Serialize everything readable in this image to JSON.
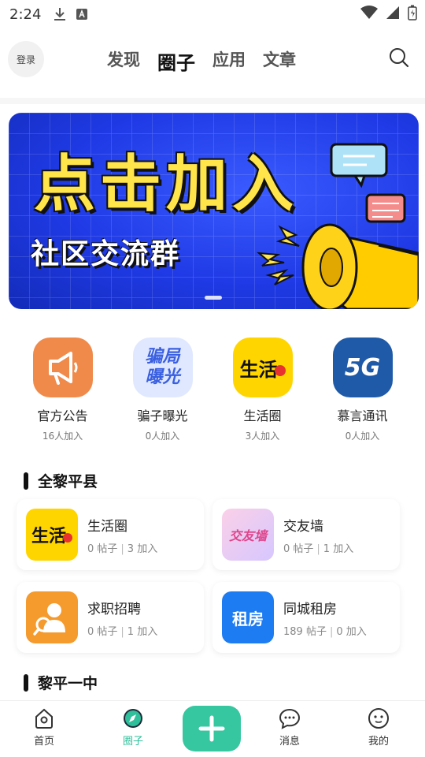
{
  "status_bar": {
    "time": "2:24"
  },
  "top_nav": {
    "login": "登录",
    "tabs": [
      "发现",
      "圈子",
      "应用",
      "文章"
    ],
    "active_tab": "圈子"
  },
  "banner": {
    "headline": "点击加入",
    "subtitle": "社区交流群"
  },
  "featured_circles": [
    {
      "name": "官方公告",
      "count": "16人加入",
      "icon": "megaphone-icon",
      "color": "#f08a4b"
    },
    {
      "name": "骗子曝光",
      "count": "0人加入",
      "icon": "scam-exposure-icon",
      "color": "#dfe8ff",
      "icon_text": "骗局曝光"
    },
    {
      "name": "生活圈",
      "count": "3人加入",
      "icon": "life-icon",
      "color": "#ffd500",
      "icon_text": "生活"
    },
    {
      "name": "慕言通讯",
      "count": "0人加入",
      "icon": "5g-icon",
      "color": "#1f5aa8",
      "icon_text": "5G"
    }
  ],
  "sections": [
    {
      "title": "全黎平县",
      "groups": [
        {
          "name": "生活圈",
          "posts": "0 帖子",
          "joined": "3 加入",
          "icon": "life-icon",
          "color": "#ffd500",
          "icon_text": "生活"
        },
        {
          "name": "交友墙",
          "posts": "0 帖子",
          "joined": "1 加入",
          "icon": "friend-wall-icon",
          "color": "#f6c7e4",
          "icon_text": "交友墙"
        },
        {
          "name": "求职招聘",
          "posts": "0 帖子",
          "joined": "1 加入",
          "icon": "job-search-icon",
          "color": "#f59a2c"
        },
        {
          "name": "同城租房",
          "posts": "189 帖子",
          "joined": "0 加入",
          "icon": "rent-icon",
          "color": "#1e7cf2",
          "icon_text": "租房"
        }
      ]
    },
    {
      "title": "黎平一中"
    }
  ],
  "bottom_nav": {
    "items": [
      "首页",
      "圈子",
      "消息",
      "我的"
    ],
    "active": "圈子"
  },
  "colors": {
    "accent": "#36c7a0",
    "banner_blue": "#1f3ae6",
    "headline_yellow": "#ffe44a"
  }
}
